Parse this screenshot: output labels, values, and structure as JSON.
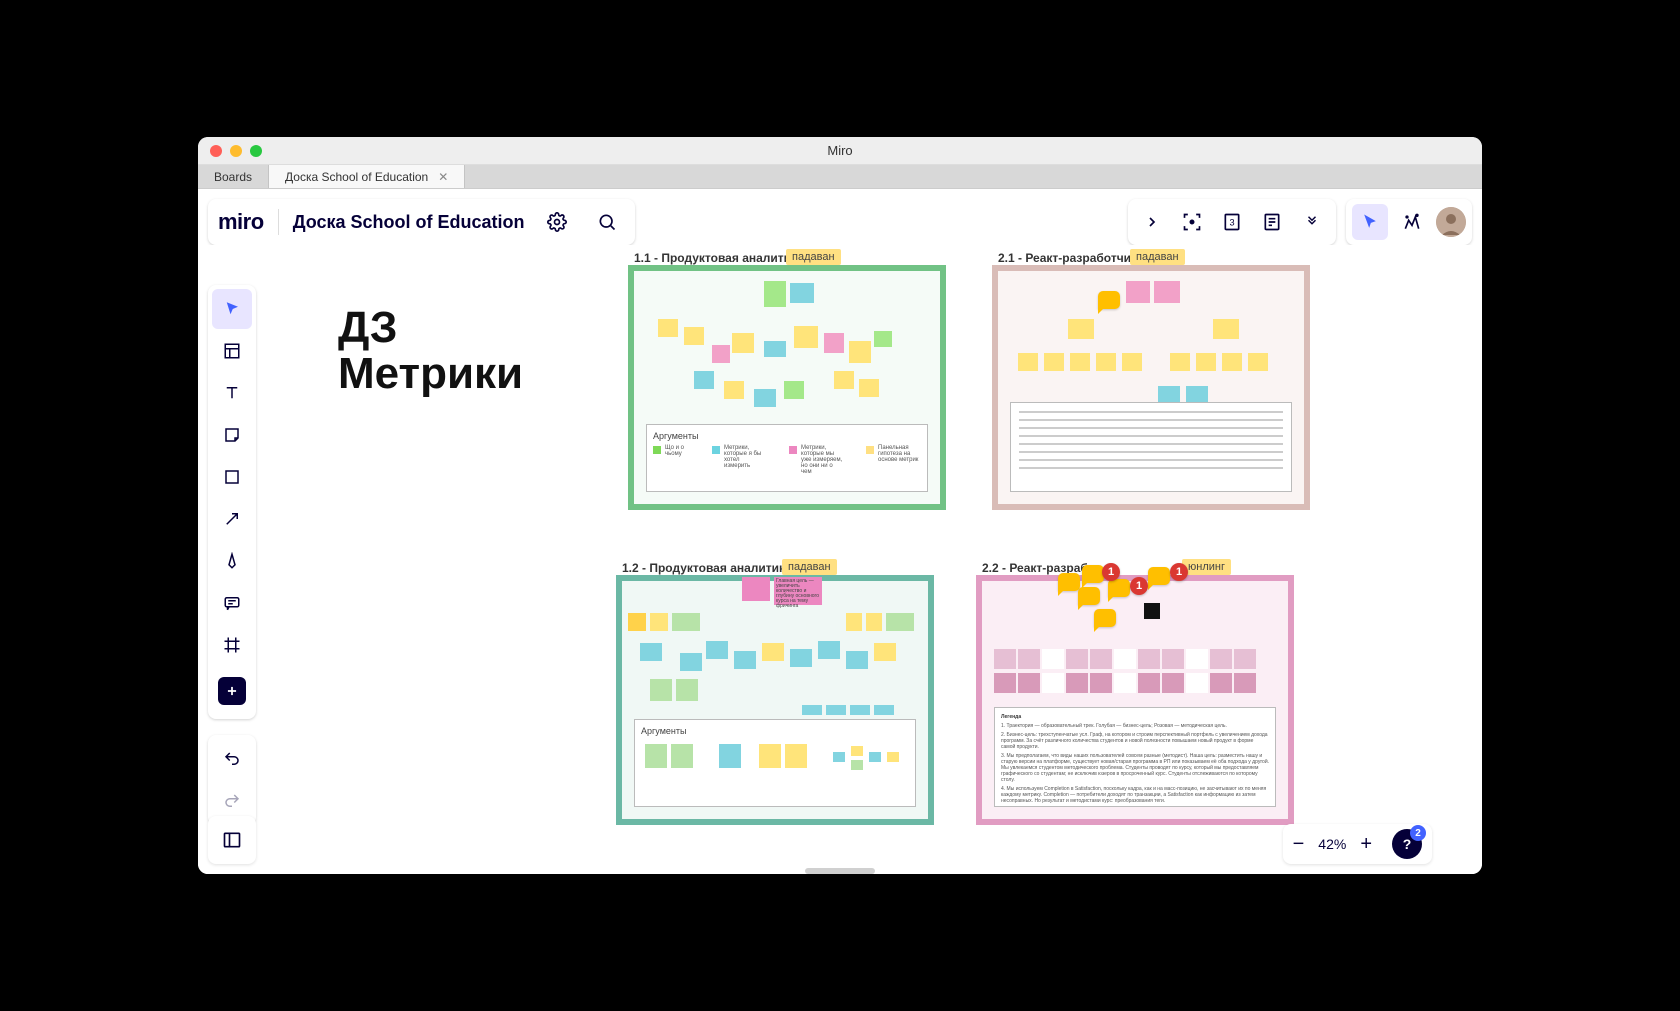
{
  "window": {
    "title": "Miro"
  },
  "tabs": [
    {
      "label": "Boards",
      "active": false
    },
    {
      "label": "Доска School of Education",
      "active": true
    }
  ],
  "appbar": {
    "logo": "miro",
    "board_title": "Доска School of Education"
  },
  "canvas": {
    "title_line1": "ДЗ",
    "title_line2": "Метрики",
    "frames": {
      "f1": {
        "label": "1.1 - Продуктовая аналитика",
        "tag": "падаван",
        "border_color": "#71c285",
        "legend_title": "Аргументы",
        "legend": [
          {
            "color": "#7ed957",
            "text": "Що и о чьому"
          },
          {
            "color": "#6cd3e0",
            "text": "Метрики, которые я бы хотел измерить"
          },
          {
            "color": "#ec87c0",
            "text": "Метрики, которые мы уже измеряем, но они ни о чем"
          },
          {
            "color": "#ffe082",
            "text": "Панельная гипотеза на основе метрик"
          }
        ]
      },
      "f2": {
        "label": "2.1 - Реакт-разработчик",
        "tag": "падаван",
        "border_color": "#d9bcb7"
      },
      "f3": {
        "label": "1.2 - Продуктовая аналитика",
        "tag": "падаван",
        "border_color": "#6bb8a5",
        "legend_title": "Аргументы",
        "top_note": "Главная цель — увеличить количество и глубину основного курса на тему фричинга"
      },
      "f4": {
        "label": "2.2 - Реакт-разработ",
        "tag": "юнлинг",
        "border_color": "#e19cc2",
        "badges": [
          "1",
          "1",
          "1"
        ],
        "textbox_header": "Легенда"
      }
    }
  },
  "zoom": {
    "value": "42%"
  },
  "help": {
    "badge": "2"
  }
}
